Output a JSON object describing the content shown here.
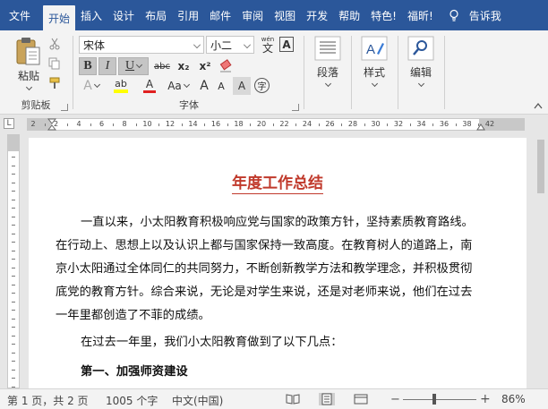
{
  "tabs": [
    "文件",
    "开始",
    "插入",
    "设计",
    "布局",
    "引用",
    "邮件",
    "审阅",
    "视图",
    "开发",
    "帮助",
    "特色!",
    "福昕!"
  ],
  "active_tab": "开始",
  "tellme": "告诉我",
  "ribbon": {
    "clipboard": {
      "paste_label": "粘贴",
      "group_label": "剪贴板"
    },
    "font": {
      "font_name": "宋体",
      "font_size": "小二",
      "wen_label": "wén",
      "wen_char": "文",
      "a_box": "A",
      "bold": "B",
      "italic": "I",
      "underline": "U",
      "strike": "abc",
      "subscript": "x₂",
      "superscript": "x²",
      "text_effects": "A",
      "highlight": "ab",
      "font_color": "A",
      "change_case": "Aa",
      "grow": "A",
      "shrink": "A",
      "char_shading": "A",
      "enclose": "字",
      "group_label": "字体"
    },
    "paragraph": {
      "label": "段落"
    },
    "styles": {
      "label": "样式"
    },
    "editing": {
      "label": "编辑"
    }
  },
  "ruler": {
    "corner": "L",
    "numbers": [
      "2",
      "2",
      "4",
      "6",
      "8",
      "10",
      "12",
      "14",
      "16",
      "18",
      "20",
      "22",
      "24",
      "26",
      "28",
      "30",
      "32",
      "34",
      "36",
      "38",
      "42"
    ]
  },
  "document": {
    "title": "年度工作总结",
    "paragraph1_lines": [
      "一直以来，小太阳教育积极响应党与国家的政策方针，坚持素质教育路线。",
      "在行动上、思想上以及认识上都与国家保持一致高度。在教育树人的道路上，南",
      "京小太阳通过全体同仁的共同努力，不断创新教学方法和教学理念，并积极贯彻",
      "底党的教育方针。综合来说，无论是对学生来说，还是对老师来说，他们在过去",
      "一年里都创造了不菲的成绩。"
    ],
    "paragraph2": "在过去一年里，我们小太阳教育做到了以下几点：",
    "heading_partial": "第一、加强师资建设"
  },
  "status": {
    "pages": "第 1 页，共 2 页",
    "words": "1005 个字",
    "language": "中文(中国)",
    "zoom_minus": "−",
    "zoom_plus": "+",
    "zoom": "86%",
    "zoom_level_percent": 86
  },
  "colors": {
    "tab_bar": "#2b579a",
    "ribbon_bg": "#f3f3f3",
    "title_red": "#c0392b",
    "highlight_yellow": "#ffff00",
    "font_color_red": "#e02020"
  }
}
